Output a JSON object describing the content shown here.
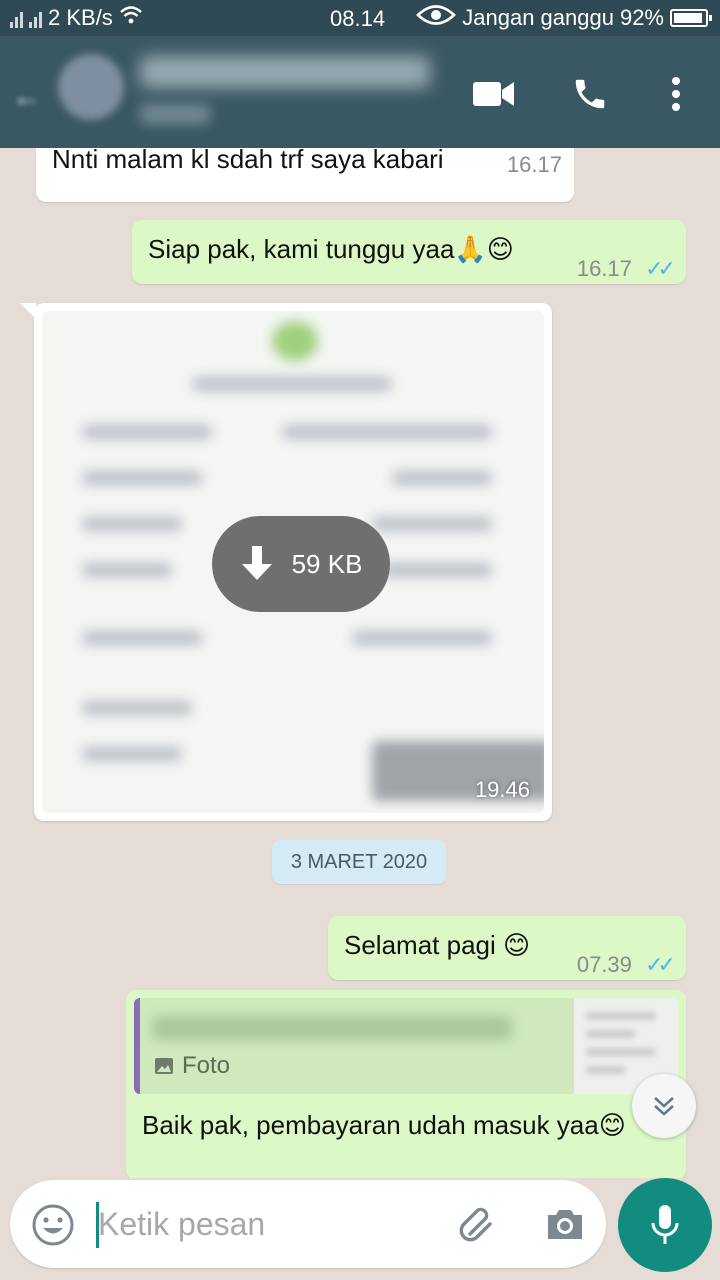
{
  "status_bar": {
    "net_speed": "2 KB/s",
    "time": "08.14",
    "mode": "Jangan ganggu",
    "battery": "92%"
  },
  "header": {
    "actions": [
      "video-call-icon",
      "phone-icon",
      "more-vert-icon"
    ]
  },
  "messages": [
    {
      "type": "incoming",
      "text": "Nnti malam kl sdah trf saya kabari",
      "time": "16.17"
    },
    {
      "type": "outgoing",
      "text": "Siap pak, kami tunggu yaa🙏😊",
      "time": "16.17",
      "ticks": "✓✓"
    },
    {
      "type": "incoming-image",
      "download_size": "59 KB",
      "time": "19.46"
    },
    {
      "type": "date",
      "text": "3 MARET 2020"
    },
    {
      "type": "outgoing",
      "text": "Selamat pagi 😊",
      "time": "07.39",
      "ticks": "✓✓"
    },
    {
      "type": "outgoing-reply",
      "quote_type": "Foto",
      "text": "Baik pak, pembayaran udah masuk yaa😊"
    }
  ],
  "composer": {
    "placeholder": "Ketik pesan"
  },
  "colors": {
    "header": "#3a5863",
    "status_bar": "#2f4a55",
    "outgoing": "#dcf8c6",
    "incoming": "#ffffff",
    "accent": "#128c7e",
    "read_ticks": "#4fb6ec"
  }
}
